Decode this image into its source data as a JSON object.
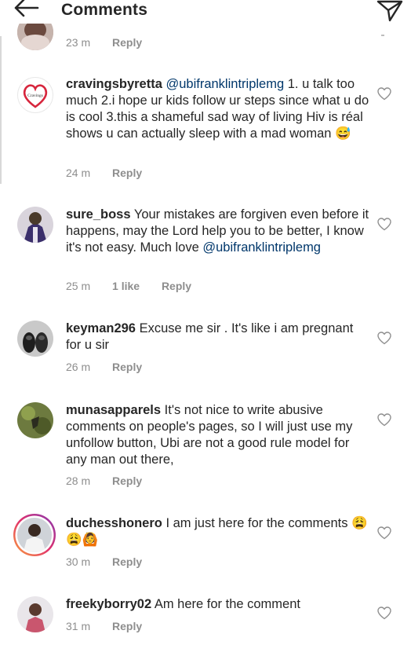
{
  "header": {
    "title": "Comments"
  },
  "top_comment": {
    "time": "23 m",
    "reply_label": "Reply"
  },
  "comments": [
    {
      "username": "cravingsbyretta",
      "mention": "@ubifranklintriplemg",
      "text": " 1. u talk too much 2.i hope ur kids follow ur steps since what u do is cool 3.this a shameful sad way of living Hiv is réal shows u can actually sleep with a mad woman ",
      "emoji": "😅",
      "time": "24 m",
      "reply_label": "Reply",
      "avatar_text": "Cravings"
    },
    {
      "username": "sure_boss",
      "text": " Your mistakes are forgiven even before it happens, may the Lord help you to be better, I know it's not easy.  Much love ",
      "mention": "@ubifranklintriplemg",
      "time": "25 m",
      "likes": "1 like",
      "reply_label": "Reply"
    },
    {
      "username": "keyman296",
      "text": " Excuse me sir . It's like i am pregnant for u sir",
      "time": "26 m",
      "reply_label": "Reply"
    },
    {
      "username": "munasapparels",
      "text": " It's not nice to write abusive comments on people's pages, so I  will just use my unfollow button, Ubi are not a good rule model for any man out there,",
      "time": "28 m",
      "reply_label": "Reply"
    },
    {
      "username": "duchesshonero",
      "text": " I am just here for the comments ",
      "emoji": "😩😩🙆",
      "time": "30 m",
      "reply_label": "Reply"
    },
    {
      "username": "freekyborry02",
      "text": " Am here for the comment",
      "time": "31 m",
      "reply_label": "Reply"
    }
  ],
  "colors": {
    "mention": "#00376b",
    "meta": "#8e8e8e",
    "text": "#262626",
    "story_ring": "#c13584"
  }
}
